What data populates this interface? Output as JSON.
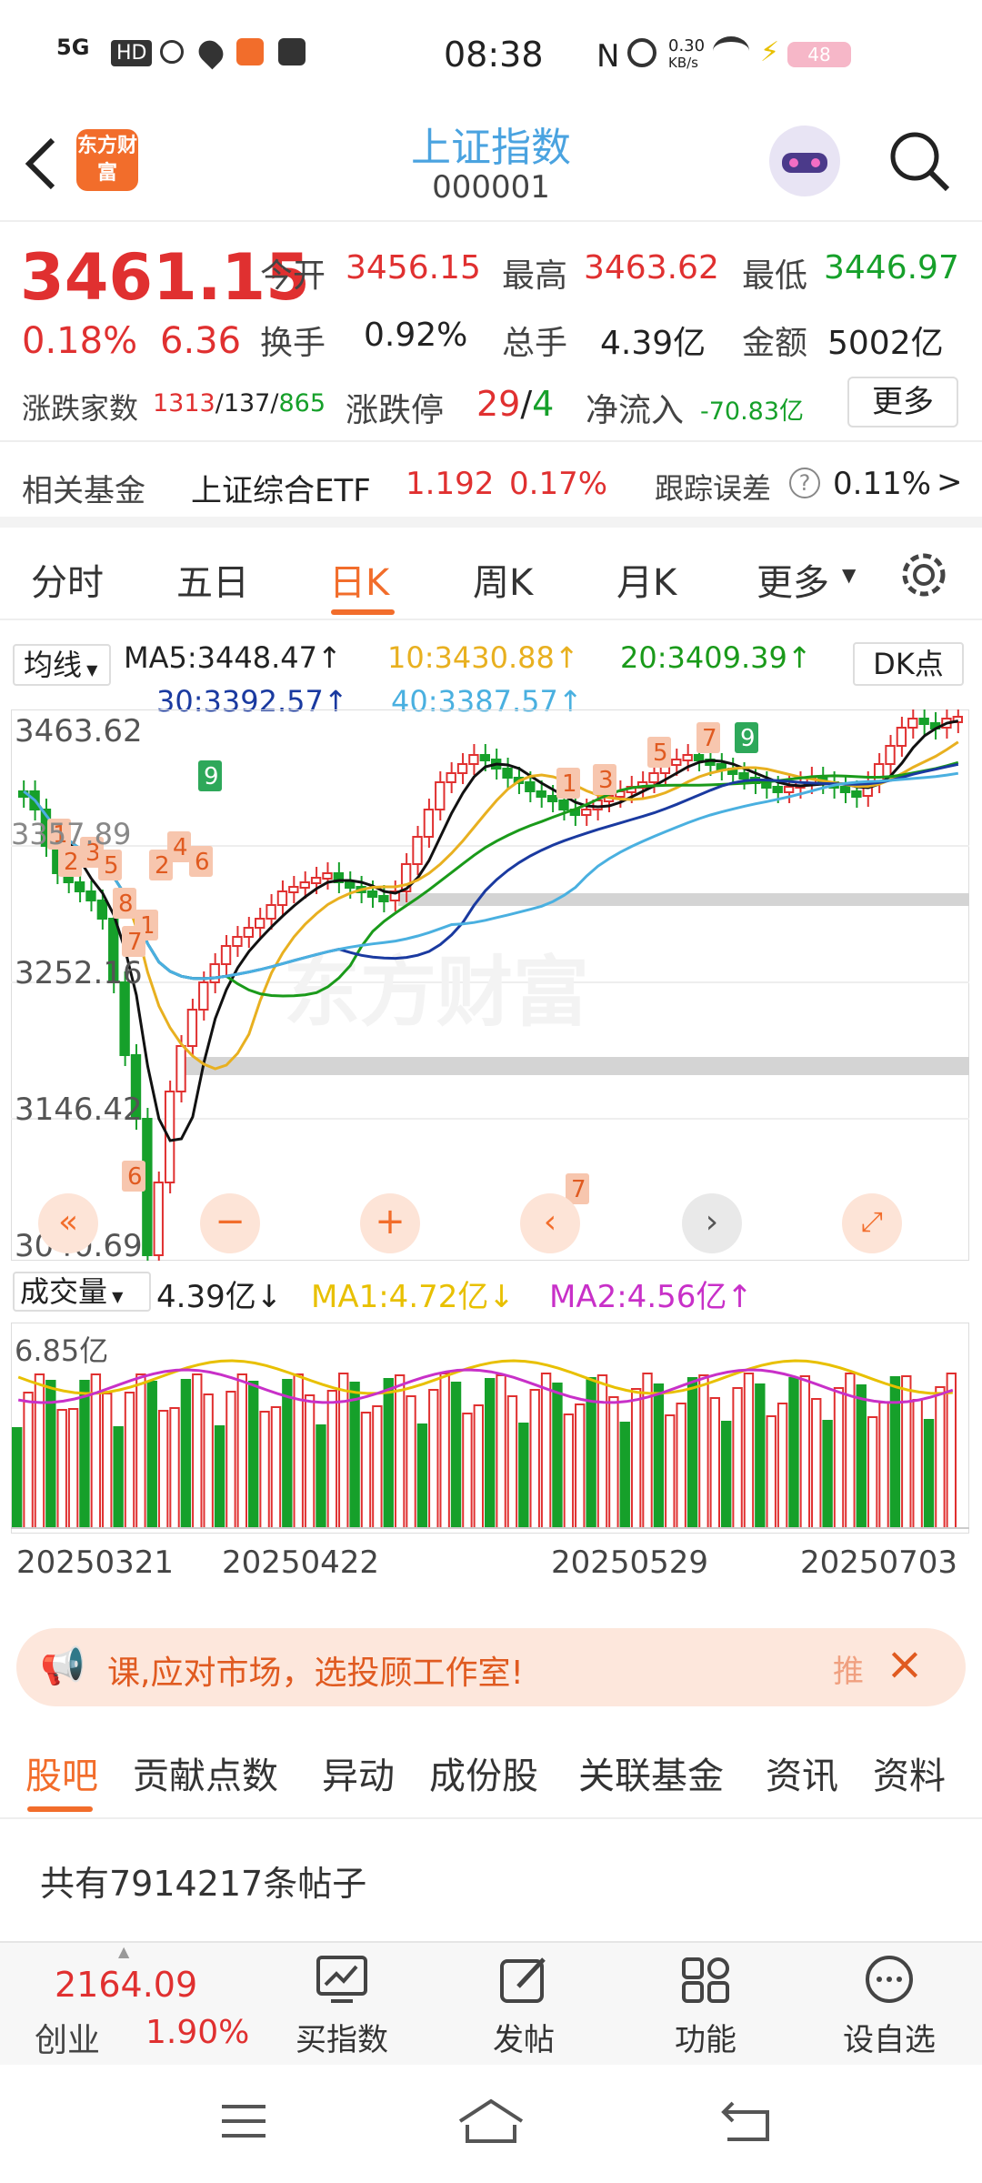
{
  "status": {
    "network": "5G",
    "hd": "HD",
    "time": "08:38",
    "speed_top": "0.30",
    "speed_unit": "KB/s",
    "battery": "48"
  },
  "header": {
    "logo_text": "东方财富",
    "title": "上证指数",
    "code": "000001"
  },
  "quote": {
    "price": "3461.15",
    "change_pct": "0.18%",
    "change": "6.36",
    "open_label": "今开",
    "open": "3456.15",
    "high_label": "最高",
    "high": "3463.62",
    "low_label": "最低",
    "low": "3446.97",
    "turnover_label": "换手",
    "turnover": "0.92%",
    "volume_label": "总手",
    "volume": "4.39亿",
    "amount_label": "金额",
    "amount": "5002亿",
    "breadth_label": "涨跌家数",
    "up": "1313",
    "flat": "137",
    "down": "865",
    "limit_label": "涨跌停",
    "limit_up": "29",
    "limit_down": "4",
    "inflow_label": "净流入",
    "inflow": "-70.83亿",
    "more": "更多"
  },
  "fund": {
    "label": "相关基金",
    "name": "上证综合ETF",
    "price": "1.192",
    "pct": "0.17%",
    "err_label": "跟踪误差",
    "err": "0.11%",
    "arrow": ">"
  },
  "tabs": [
    "分时",
    "五日",
    "日K",
    "周K",
    "月K",
    "更多"
  ],
  "active_tab": 2,
  "ma": {
    "selector": "均线",
    "ma5": "MA5:3448.47↑",
    "ma10": "10:3430.88↑",
    "ma20": "20:3409.39↑",
    "ma30": "30:3392.57↑",
    "ma40": "40:3387.57↑",
    "dk": "DK点"
  },
  "chart_data": {
    "type": "candlestick",
    "y_labels": [
      "3463.62",
      "3252.16",
      "3146.42",
      "3040.69"
    ],
    "x_labels": [
      "20250321",
      "20250422",
      "20250529",
      "20250703"
    ],
    "left_price_label": "3357.89",
    "volume_panel": {
      "selector": "成交量",
      "value": "4.39亿↓",
      "ma1": "MA1:4.72亿↓",
      "ma2": "MA2:4.56亿↑",
      "top_label": "6.85亿"
    }
  },
  "promo": {
    "text": "课,应对市场，选投顾工作室!",
    "tag": "推"
  },
  "guba": {
    "tabs": [
      "股吧",
      "贡献点数",
      "异动",
      "成份股",
      "关联基金",
      "资讯",
      "资料"
    ],
    "posts": "共有7914217条帖子"
  },
  "bottom": {
    "index_value": "2164.09",
    "index_name": "创业",
    "index_pct": "1.90%",
    "buy": "买指数",
    "post": "发帖",
    "func": "功能",
    "watch": "设自选"
  }
}
